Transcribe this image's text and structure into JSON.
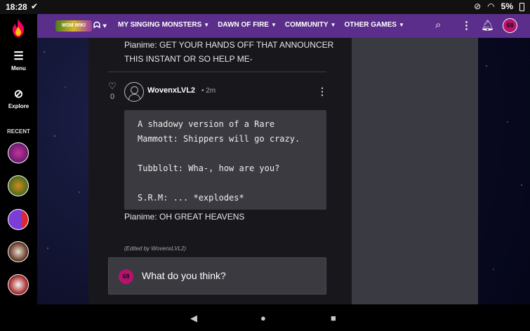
{
  "status_bar": {
    "time": "18:28",
    "battery": "5%"
  },
  "rail": {
    "menu_label": "Menu",
    "explore_label": "Explore",
    "recent_label": "RECENT"
  },
  "header": {
    "wiki_logo_text": "MSM WIKI",
    "nav_items": [
      "MY SINGING MONSTERS",
      "DAWN OF FIRE",
      "COMMUNITY",
      "OTHER GAMES"
    ],
    "user_avatar_text": "68",
    "brand_color": "#5a2e8a"
  },
  "thread": {
    "previous_text": "Pianime: GET YOUR HANDS OFF THAT ANNOUNCER THIS INSTANT OR SO HELP ME-",
    "comment": {
      "like_count": "0",
      "username": "WovenxLVL2",
      "time": "• 2m",
      "code_lines": [
        "A shadowy version of a Rare",
        "Mammott: Shippers will go crazy.",
        "",
        "Tubblolt: Wha-, how are you?",
        "",
        "S.R.M: ... *explodes*"
      ],
      "reply_text": "Pianime: OH GREAT HEAVENS",
      "edited_note": "(Edited by WovenxLVL2)"
    },
    "compose": {
      "avatar_text": "68",
      "placeholder": "What do you think?"
    }
  },
  "colors": {
    "accent_pink": "#b8116f",
    "panel_bg": "#17171c",
    "code_bg": "#3a3a40"
  }
}
